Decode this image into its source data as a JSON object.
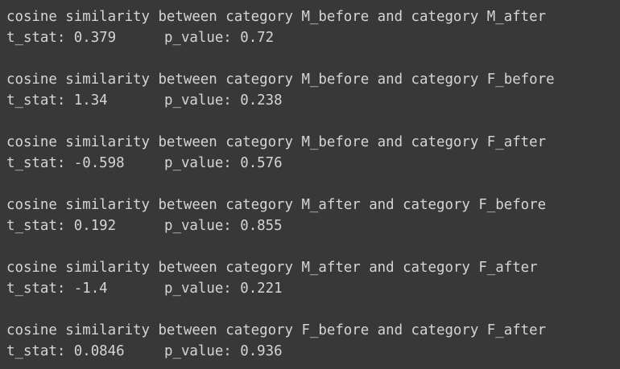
{
  "output": {
    "blocks": [
      {
        "heading": "cosine similarity between category M_before and category M_after",
        "t_stat": "t_stat: 0.379",
        "p_value": "p_value: 0.72"
      },
      {
        "heading": "cosine similarity between category M_before and category F_before",
        "t_stat": "t_stat: 1.34",
        "p_value": "p_value: 0.238"
      },
      {
        "heading": "cosine similarity between category M_before and category F_after",
        "t_stat": "t_stat: -0.598",
        "p_value": "p_value: 0.576"
      },
      {
        "heading": "cosine similarity between category M_after and category F_before",
        "t_stat": "t_stat: 0.192",
        "p_value": "p_value: 0.855"
      },
      {
        "heading": "cosine similarity between category M_after and category F_after",
        "t_stat": "t_stat: -1.4",
        "p_value": "p_value: 0.221"
      },
      {
        "heading": "cosine similarity between category F_before and category F_after",
        "t_stat": "t_stat: 0.0846",
        "p_value": "p_value: 0.936"
      }
    ]
  }
}
